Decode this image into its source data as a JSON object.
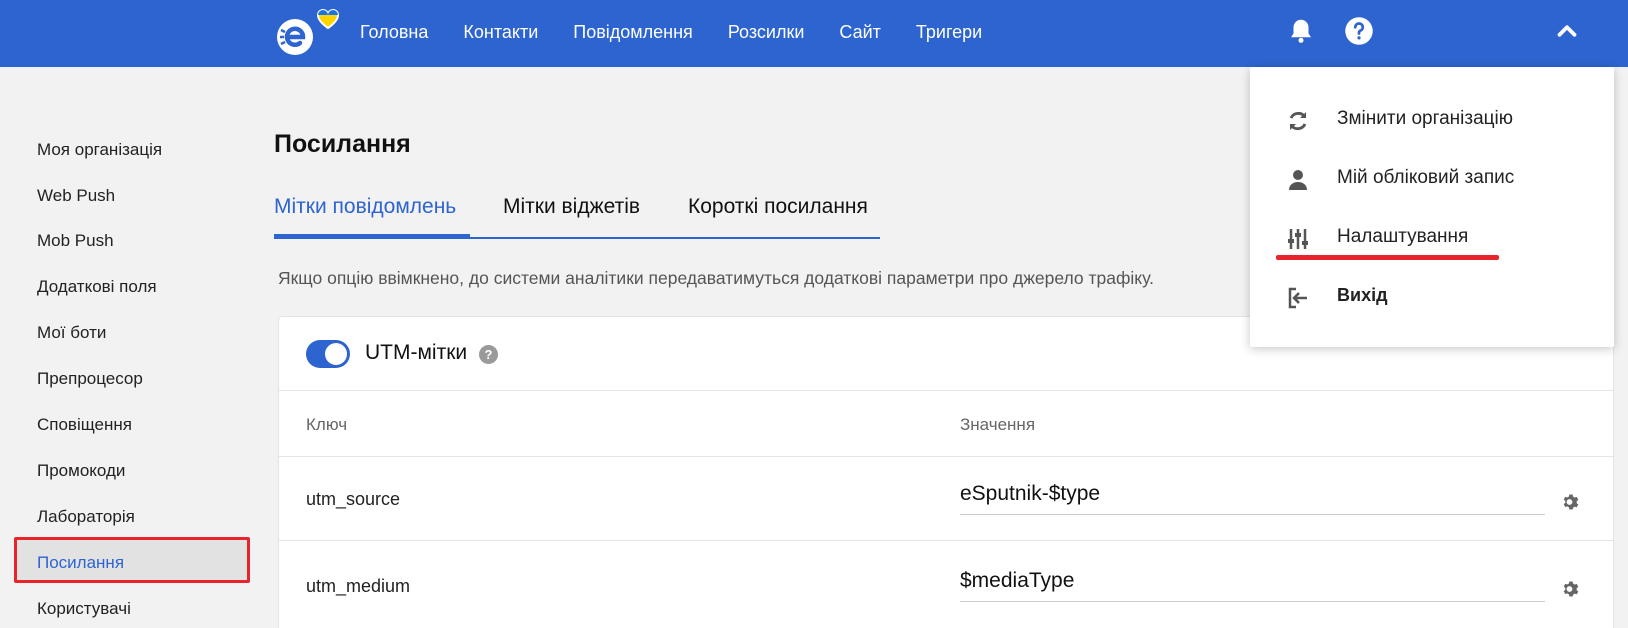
{
  "topbar": {
    "nav": [
      "Головна",
      "Контакти",
      "Повідомлення",
      "Розсилки",
      "Сайт",
      "Тригери"
    ],
    "colors": {
      "brand": "#2d64cf",
      "logo_heart_top": "#1a73e8",
      "logo_heart_bottom": "#ffd500"
    },
    "icons": [
      "logo-icon",
      "bell-icon",
      "help-icon",
      "chevron-up-icon"
    ]
  },
  "sidebar": {
    "items": [
      {
        "label": "Моя організація"
      },
      {
        "label": "Web Push"
      },
      {
        "label": "Mob Push"
      },
      {
        "label": "Додаткові поля"
      },
      {
        "label": "Мої боти"
      },
      {
        "label": "Препроцесор"
      },
      {
        "label": "Сповіщення"
      },
      {
        "label": "Промокоди"
      },
      {
        "label": "Лабораторія"
      },
      {
        "label": "Посилання",
        "active": true
      },
      {
        "label": "Користувачі"
      }
    ]
  },
  "main": {
    "title": "Посилання",
    "tabs": [
      {
        "label": "Мітки повідомлень",
        "active": true
      },
      {
        "label": "Мітки віджетів"
      },
      {
        "label": "Короткі посилання"
      }
    ],
    "description": "Якщо опцію ввімкнено, до системи аналітики передаватимуться додаткові параметри про джерело трафіку.",
    "card": {
      "toggle_on": true,
      "toggle_label": "UTM-мітки",
      "help_glyph": "?",
      "columns": [
        "Ключ",
        "Значення"
      ],
      "rows": [
        {
          "key": "utm_source",
          "value": "eSputnik-$type"
        },
        {
          "key": "utm_medium",
          "value": "$mediaType"
        }
      ]
    }
  },
  "dropdown": {
    "items": [
      {
        "label": "Змінити організацію",
        "icon": "sync-icon"
      },
      {
        "label": "Мій обліковий запис",
        "icon": "user-icon"
      },
      {
        "label": "Налаштування",
        "icon": "sliders-icon",
        "highlighted": true
      },
      {
        "label": "Вихід",
        "icon": "logout-icon"
      }
    ]
  },
  "annotation_color": "#e8232b"
}
